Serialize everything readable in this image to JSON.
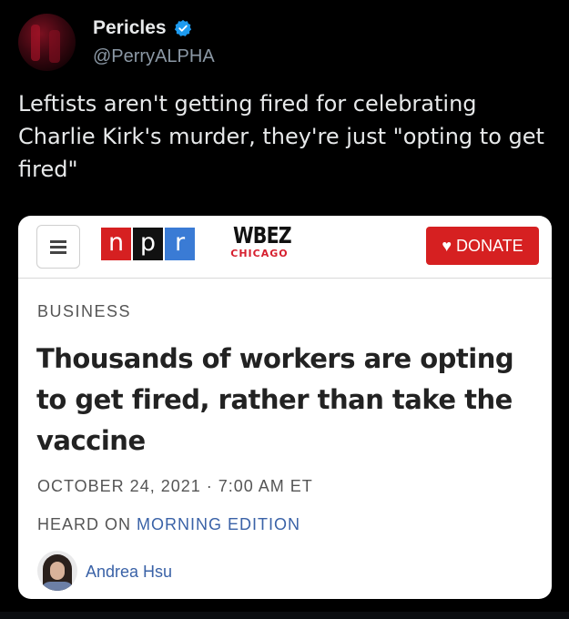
{
  "tweet": {
    "display_name": "Pericles",
    "handle": "@PerryALPHA",
    "verified": true,
    "text": "Leftists aren't getting fired for celebrating Charlie Kirk's murder, they're just \"opting to get fired\"",
    "verified_color": "#1d9bf0"
  },
  "article": {
    "npr_letters": [
      "n",
      "p",
      "r"
    ],
    "npr_colors": [
      "#d62021",
      "#111111",
      "#3a7bd5"
    ],
    "station_name": "WBEZ",
    "station_city": "CHICAGO",
    "donate_label": "DONATE",
    "donate_color": "#d62021",
    "category": "BUSINESS",
    "headline": "Thousands of workers are opting to get fired, rather than take the vaccine",
    "date": "OCTOBER 24, 2021 · 7:00 AM ET",
    "heard_on_prefix": "HEARD ON ",
    "program": "MORNING EDITION",
    "author": "Andrea Hsu"
  }
}
